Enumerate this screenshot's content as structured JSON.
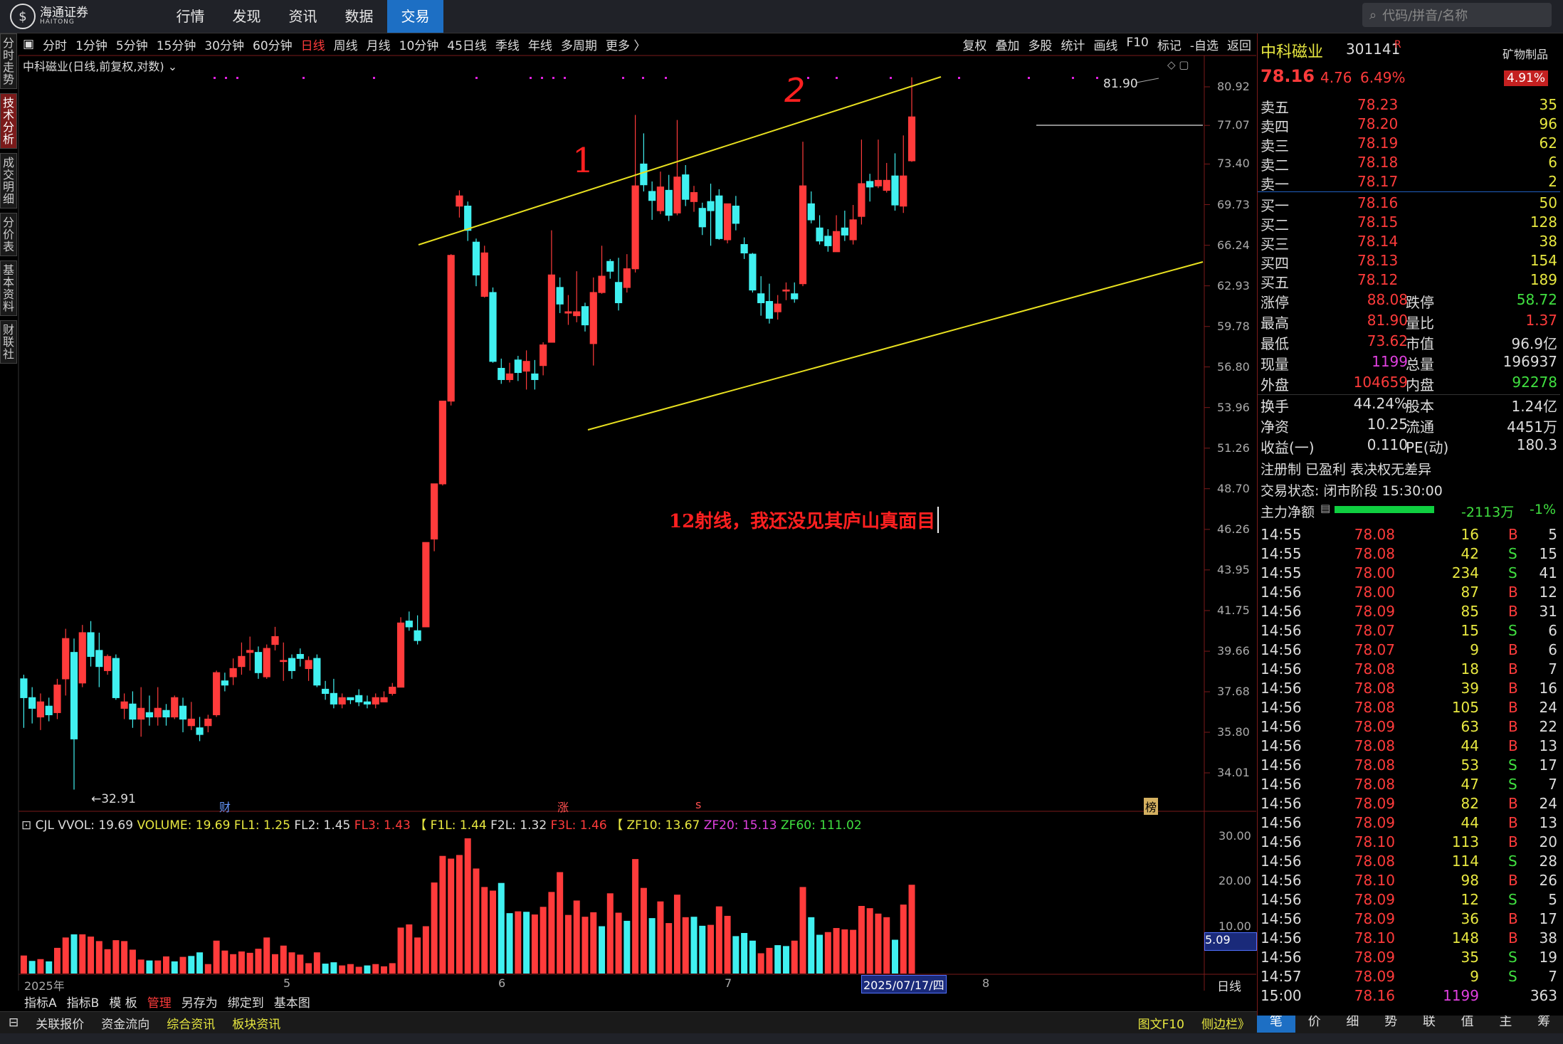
{
  "app": {
    "logo_text": "海通证券",
    "logo_sub": "HAITONG",
    "nav": [
      "行情",
      "发现",
      "资讯",
      "数据",
      "交易"
    ],
    "active_nav": "交易",
    "search_placeholder": "代码/拼音/名称"
  },
  "side_tabs": [
    "分时走势",
    "技术分析",
    "成交明细",
    "分价表",
    "基本资料",
    "财联社"
  ],
  "active_side": "技术分析",
  "toolbar": {
    "periods": [
      "分时",
      "1分钟",
      "5分钟",
      "15分钟",
      "30分钟",
      "60分钟",
      "日线",
      "周线",
      "月线",
      "10分钟",
      "45日线",
      "季线",
      "年线",
      "多周期",
      "更多 〉"
    ],
    "active": "日线",
    "right": [
      "复权",
      "叠加",
      "多股",
      "统计",
      "画线",
      "F10",
      "标记",
      "-自选",
      "返回"
    ]
  },
  "chart_title": "中科磁业(日线,前复权,对数)",
  "annotation_text": "12射线，我还没见其庐山真面目",
  "marks": {
    "one": "1",
    "two": "2",
    "high": "81.90",
    "low": "←32.91",
    "cai": "财",
    "zhang": "涨",
    "s": "s",
    "bang": "榜"
  },
  "y_ticks": [
    "80.92",
    "77.07",
    "73.40",
    "69.73",
    "66.24",
    "62.93",
    "59.78",
    "56.80",
    "53.96",
    "51.26",
    "48.70",
    "46.26",
    "43.95",
    "41.75",
    "39.66",
    "37.68",
    "35.80",
    "34.01"
  ],
  "vol_header": {
    "cjl": "CJL",
    "vvol": "VVOL: 19.69",
    "volume": "VOLUME: 19.69",
    "fl1": "FL1: 1.25",
    "fl2": "FL2: 1.45",
    "fl3": "FL3: 1.43",
    "bracket1": "【",
    "f1l": "F1L: 1.44",
    "f2l": "F2L: 1.32",
    "f3l": "F3L: 1.46",
    "bracket2": "【",
    "zf10": "ZF10: 13.67",
    "zf20": "ZF20: 15.13",
    "zf60": "ZF60: 111.02"
  },
  "vol_ticks": [
    "30.00",
    "20.00",
    "10.00"
  ],
  "vol_current": "5.09",
  "x_labels": [
    "2025年",
    "5",
    "6",
    "7",
    "2025/07/17/四",
    "8"
  ],
  "period_label": "日线",
  "bottom_tabs": [
    "指标A",
    "指标B",
    "模 板",
    "管理",
    "另存为",
    "绑定到",
    "基本图"
  ],
  "status_tabs": [
    "关联报价",
    "资金流向",
    "综合资讯",
    "板块资讯"
  ],
  "status_right": [
    "图文F10",
    "侧边栏》"
  ],
  "quote": {
    "name": "中科磁业",
    "code": "301141",
    "tag": "R",
    "sector": "矿物制品",
    "sector_pct": "4.91%",
    "price": "78.16",
    "change": "4.76",
    "pct": "6.49%",
    "asks": [
      [
        "卖五",
        "78.23",
        "35"
      ],
      [
        "卖四",
        "78.20",
        "96"
      ],
      [
        "卖三",
        "78.19",
        "62"
      ],
      [
        "卖二",
        "78.18",
        "6"
      ],
      [
        "卖一",
        "78.17",
        "2"
      ]
    ],
    "bids": [
      [
        "买一",
        "78.16",
        "50"
      ],
      [
        "买二",
        "78.15",
        "128"
      ],
      [
        "买三",
        "78.14",
        "38"
      ],
      [
        "买四",
        "78.13",
        "154"
      ],
      [
        "买五",
        "78.12",
        "189"
      ]
    ],
    "stats": [
      [
        "涨停",
        "88.08",
        "跌停",
        "58.72"
      ],
      [
        "最高",
        "81.90",
        "量比",
        "1.37"
      ],
      [
        "最低",
        "73.62",
        "市值",
        "96.9亿"
      ],
      [
        "现量",
        "1199",
        "总量",
        "196937"
      ],
      [
        "外盘",
        "104659",
        "内盘",
        "92278"
      ]
    ],
    "stats2": [
      [
        "换手",
        "44.24%",
        "股本",
        "1.24亿"
      ],
      [
        "净资",
        "10.25",
        "流通",
        "4451万"
      ],
      [
        "收益(一)",
        "0.110",
        "PE(动)",
        "180.3"
      ]
    ],
    "reg": "注册制 已盈利 表决权无差异",
    "trade_status": "交易状态: 闭市阶段 15:30:00",
    "main_flow_label": "主力净额",
    "main_flow_value": "-2113万",
    "main_flow_pct": "-1%"
  },
  "ticks": [
    [
      "14:55",
      "78.08",
      "16",
      "B",
      "5"
    ],
    [
      "14:55",
      "78.08",
      "42",
      "S",
      "15"
    ],
    [
      "14:55",
      "78.00",
      "234",
      "S",
      "41"
    ],
    [
      "14:56",
      "78.00",
      "87",
      "B",
      "12"
    ],
    [
      "14:56",
      "78.09",
      "85",
      "B",
      "31"
    ],
    [
      "14:56",
      "78.07",
      "15",
      "S",
      "6"
    ],
    [
      "14:56",
      "78.07",
      "9",
      "B",
      "6"
    ],
    [
      "14:56",
      "78.08",
      "18",
      "B",
      "7"
    ],
    [
      "14:56",
      "78.08",
      "39",
      "B",
      "16"
    ],
    [
      "14:56",
      "78.08",
      "105",
      "B",
      "24"
    ],
    [
      "14:56",
      "78.09",
      "63",
      "B",
      "22"
    ],
    [
      "14:56",
      "78.08",
      "44",
      "B",
      "13"
    ],
    [
      "14:56",
      "78.08",
      "53",
      "S",
      "17"
    ],
    [
      "14:56",
      "78.08",
      "47",
      "S",
      "7"
    ],
    [
      "14:56",
      "78.09",
      "82",
      "B",
      "24"
    ],
    [
      "14:56",
      "78.09",
      "44",
      "B",
      "13"
    ],
    [
      "14:56",
      "78.10",
      "113",
      "B",
      "20"
    ],
    [
      "14:56",
      "78.08",
      "114",
      "S",
      "28"
    ],
    [
      "14:56",
      "78.10",
      "98",
      "B",
      "26"
    ],
    [
      "14:56",
      "78.09",
      "12",
      "S",
      "5"
    ],
    [
      "14:56",
      "78.09",
      "36",
      "B",
      "17"
    ],
    [
      "14:56",
      "78.10",
      "148",
      "B",
      "38"
    ],
    [
      "14:56",
      "78.09",
      "35",
      "S",
      "19"
    ],
    [
      "14:57",
      "78.09",
      "9",
      "S",
      "7"
    ],
    [
      "15:00",
      "78.16",
      "1199",
      "",
      "363"
    ]
  ],
  "tick_tabs": [
    "笔",
    "价",
    "细",
    "势",
    "联",
    "值",
    "主",
    "筹"
  ],
  "candles": [
    [
      38.3,
      37.4,
      38.5,
      36.0
    ],
    [
      37.4,
      36.9,
      37.9,
      36.2
    ],
    [
      36.5,
      37.2,
      37.6,
      35.9
    ],
    [
      37.0,
      36.6,
      37.4,
      36.3
    ],
    [
      36.7,
      38.0,
      38.3,
      36.4
    ],
    [
      38.3,
      40.3,
      40.8,
      37.5
    ],
    [
      39.6,
      35.5,
      40.3,
      33.3
    ],
    [
      38.1,
      40.6,
      41.0,
      37.9
    ],
    [
      40.6,
      39.4,
      41.2,
      38.9
    ],
    [
      39.7,
      38.9,
      40.6,
      37.9
    ],
    [
      38.7,
      39.4,
      39.5,
      38.5
    ],
    [
      39.3,
      37.4,
      39.5,
      37.3
    ],
    [
      36.9,
      37.2,
      37.6,
      36.4
    ],
    [
      37.1,
      36.4,
      37.7,
      36.0
    ],
    [
      36.4,
      36.9,
      37.9,
      35.6
    ],
    [
      36.7,
      36.5,
      37.5,
      36.1
    ],
    [
      36.5,
      36.9,
      37.9,
      36.1
    ],
    [
      36.8,
      36.5,
      37.1,
      36.1
    ],
    [
      36.5,
      37.4,
      37.5,
      36.4
    ],
    [
      37.0,
      36.4,
      37.4,
      35.8
    ],
    [
      36.1,
      36.4,
      37.2,
      35.9
    ],
    [
      36.0,
      35.7,
      36.5,
      35.4
    ],
    [
      36.1,
      36.4,
      36.6,
      35.8
    ],
    [
      36.6,
      38.6,
      38.7,
      36.5
    ],
    [
      38.2,
      38.0,
      38.6,
      37.7
    ],
    [
      38.4,
      38.8,
      39.3,
      38.0
    ],
    [
      38.9,
      39.4,
      40.1,
      38.5
    ],
    [
      39.6,
      39.7,
      40.4,
      38.7
    ],
    [
      39.6,
      38.6,
      39.9,
      38.3
    ],
    [
      38.4,
      39.8,
      40.0,
      38.3
    ],
    [
      40.0,
      40.4,
      40.9,
      39.7
    ],
    [
      39.2,
      39.2,
      40.1,
      38.2
    ],
    [
      39.3,
      38.7,
      39.5,
      38.3
    ],
    [
      39.5,
      39.3,
      39.8,
      38.9
    ],
    [
      38.8,
      39.2,
      39.4,
      38.2
    ],
    [
      39.3,
      38.0,
      39.5,
      37.9
    ],
    [
      37.8,
      37.6,
      38.2,
      37.3
    ],
    [
      37.6,
      37.1,
      38.3,
      36.9
    ],
    [
      37.1,
      37.4,
      37.6,
      36.9
    ],
    [
      37.4,
      37.3,
      37.4,
      37.1
    ],
    [
      37.5,
      37.2,
      37.8,
      37.0
    ],
    [
      37.2,
      37.1,
      37.5,
      36.9
    ],
    [
      37.1,
      37.4,
      37.6,
      36.9
    ],
    [
      37.2,
      37.4,
      37.7,
      37.3
    ],
    [
      37.6,
      37.9,
      38.1,
      37.5
    ],
    [
      37.9,
      41.1,
      41.4,
      37.9
    ],
    [
      41.2,
      40.9,
      41.7,
      40.7
    ],
    [
      40.7,
      40.2,
      41.5,
      40.0
    ],
    [
      40.9,
      45.5,
      45.5,
      40.9
    ],
    [
      45.7,
      49.0,
      49.0,
      45.0
    ],
    [
      49.0,
      54.4,
      54.4,
      48.9
    ],
    [
      54.4,
      65.4,
      65.5,
      54.1
    ],
    [
      69.6,
      70.5,
      71.0,
      68.6
    ],
    [
      69.6,
      67.5,
      70.0,
      66.6
    ],
    [
      66.5,
      63.8,
      66.8,
      62.9
    ],
    [
      62.1,
      65.6,
      66.2,
      62.0
    ],
    [
      62.4,
      57.2,
      62.8,
      57.1
    ],
    [
      56.7,
      55.9,
      57.4,
      55.6
    ],
    [
      55.9,
      56.3,
      57.1,
      55.7
    ],
    [
      57.3,
      56.4,
      57.6,
      55.8
    ],
    [
      56.5,
      57.2,
      58.0,
      55.2
    ],
    [
      56.3,
      55.9,
      57.3,
      55.2
    ],
    [
      56.9,
      58.4,
      58.6,
      56.2
    ],
    [
      58.6,
      63.8,
      67.5,
      58.6
    ],
    [
      62.8,
      61.5,
      63.6,
      60.8
    ],
    [
      60.8,
      60.9,
      62.2,
      59.9
    ],
    [
      60.6,
      60.9,
      64.1,
      60.1
    ],
    [
      61.3,
      59.9,
      61.6,
      59.4
    ],
    [
      58.5,
      62.4,
      63.6,
      56.9
    ],
    [
      62.4,
      63.7,
      66.2,
      62.3
    ],
    [
      64.9,
      64.1,
      65.1,
      63.5
    ],
    [
      63.2,
      61.6,
      65.2,
      61.0
    ],
    [
      62.8,
      64.3,
      65.5,
      62.4
    ],
    [
      64.3,
      71.4,
      78.1,
      64.0
    ],
    [
      73.4,
      71.5,
      76.3,
      70.9
    ],
    [
      70.9,
      70.1,
      71.8,
      68.4
    ],
    [
      69.2,
      71.3,
      72.7,
      68.9
    ],
    [
      71.0,
      68.8,
      72.4,
      68.3
    ],
    [
      69.0,
      72.2,
      77.6,
      68.8
    ],
    [
      72.4,
      70.2,
      73.3,
      69.6
    ],
    [
      70.0,
      70.8,
      71.4,
      69.1
    ],
    [
      69.4,
      67.8,
      69.9,
      67.1
    ],
    [
      70.0,
      69.2,
      71.6,
      66.2
    ],
    [
      70.5,
      66.8,
      71.1,
      66.7
    ],
    [
      66.7,
      69.8,
      69.8,
      66.4
    ],
    [
      69.6,
      68.1,
      70.5,
      67.5
    ],
    [
      66.3,
      65.6,
      66.9,
      65.1
    ],
    [
      65.5,
      62.6,
      65.6,
      62.4
    ],
    [
      62.3,
      61.6,
      63.7,
      60.6
    ],
    [
      61.7,
      60.4,
      63.1,
      60.0
    ],
    [
      60.9,
      61.5,
      62.2,
      60.3
    ],
    [
      62.6,
      62.6,
      63.2,
      61.8
    ],
    [
      62.3,
      61.9,
      63.2,
      61.6
    ],
    [
      63.1,
      71.4,
      75.5,
      62.9
    ],
    [
      69.8,
      68.4,
      70.9,
      68.1
    ],
    [
      67.7,
      66.6,
      68.8,
      66.3
    ],
    [
      67.0,
      66.2,
      67.6,
      65.7
    ],
    [
      65.7,
      67.4,
      68.8,
      65.7
    ],
    [
      67.7,
      67.1,
      69.2,
      66.6
    ],
    [
      66.7,
      68.4,
      69.7,
      66.3
    ],
    [
      68.7,
      71.6,
      75.7,
      68.0
    ],
    [
      71.8,
      71.3,
      72.5,
      70.0
    ],
    [
      71.4,
      71.9,
      75.7,
      71.2
    ],
    [
      71.0,
      71.9,
      73.5,
      70.8
    ],
    [
      72.3,
      69.7,
      74.4,
      69.2
    ],
    [
      69.6,
      72.3,
      76.1,
      69.0
    ],
    [
      73.7,
      77.9,
      81.9,
      73.6
    ]
  ],
  "volumes": [
    [
      4.0,
      "u"
    ],
    [
      2.8,
      "d"
    ],
    [
      3.2,
      "u"
    ],
    [
      2.7,
      "d"
    ],
    [
      5.7,
      "u"
    ],
    [
      8.0,
      "u"
    ],
    [
      8.7,
      "d"
    ],
    [
      8.7,
      "u"
    ],
    [
      8.2,
      "u"
    ],
    [
      7.2,
      "u"
    ],
    [
      5.4,
      "u"
    ],
    [
      7.4,
      "u"
    ],
    [
      7.2,
      "u"
    ],
    [
      5.3,
      "u"
    ],
    [
      3.1,
      "u"
    ],
    [
      2.9,
      "d"
    ],
    [
      2.9,
      "u"
    ],
    [
      3.8,
      "u"
    ],
    [
      2.7,
      "d"
    ],
    [
      3.7,
      "u"
    ],
    [
      3.9,
      "d"
    ],
    [
      4.7,
      "d"
    ],
    [
      2.1,
      "u"
    ],
    [
      7.3,
      "u"
    ],
    [
      5.1,
      "u"
    ],
    [
      4.3,
      "u"
    ],
    [
      4.9,
      "u"
    ],
    [
      4.6,
      "u"
    ],
    [
      5.5,
      "u"
    ],
    [
      8.0,
      "u"
    ],
    [
      4.3,
      "u"
    ],
    [
      6.2,
      "u"
    ],
    [
      4.7,
      "u"
    ],
    [
      4.2,
      "u"
    ],
    [
      2.3,
      "u"
    ],
    [
      4.7,
      "u"
    ],
    [
      2.2,
      "d"
    ],
    [
      2.5,
      "d"
    ],
    [
      1.8,
      "u"
    ],
    [
      2.1,
      "u"
    ],
    [
      1.5,
      "u"
    ],
    [
      1.8,
      "d"
    ],
    [
      2.1,
      "u"
    ],
    [
      1.6,
      "u"
    ],
    [
      2.3,
      "u"
    ],
    [
      10.2,
      "u"
    ],
    [
      10.9,
      "u"
    ],
    [
      8.0,
      "u"
    ],
    [
      10.5,
      "u"
    ],
    [
      20.2,
      "u"
    ],
    [
      26.1,
      "u"
    ],
    [
      25.5,
      "u"
    ],
    [
      26.3,
      "u"
    ],
    [
      30.0,
      "u"
    ],
    [
      23.3,
      "u"
    ],
    [
      19.2,
      "u"
    ],
    [
      18.4,
      "u"
    ],
    [
      20.1,
      "d"
    ],
    [
      13.4,
      "d"
    ],
    [
      13.8,
      "u"
    ],
    [
      13.7,
      "d"
    ],
    [
      13.1,
      "u"
    ],
    [
      14.8,
      "u"
    ],
    [
      18.1,
      "u"
    ],
    [
      22.5,
      "u"
    ],
    [
      13.0,
      "u"
    ],
    [
      16.2,
      "u"
    ],
    [
      12.6,
      "u"
    ],
    [
      13.6,
      "u"
    ],
    [
      10.5,
      "d"
    ],
    [
      17.8,
      "u"
    ],
    [
      13.5,
      "u"
    ],
    [
      11.7,
      "d"
    ],
    [
      25.4,
      "u"
    ],
    [
      19.0,
      "u"
    ],
    [
      12.3,
      "d"
    ],
    [
      16.0,
      "u"
    ],
    [
      11.2,
      "u"
    ],
    [
      17.5,
      "u"
    ],
    [
      12.5,
      "u"
    ],
    [
      12.6,
      "d"
    ],
    [
      10.6,
      "d"
    ],
    [
      10.8,
      "u"
    ],
    [
      14.9,
      "u"
    ],
    [
      12.8,
      "u"
    ],
    [
      8.3,
      "d"
    ],
    [
      9.0,
      "d"
    ],
    [
      7.3,
      "d"
    ],
    [
      4.5,
      "u"
    ],
    [
      5.7,
      "u"
    ],
    [
      6.3,
      "d"
    ],
    [
      6.1,
      "d"
    ],
    [
      7.3,
      "u"
    ],
    [
      19.2,
      "u"
    ],
    [
      12.5,
      "d"
    ],
    [
      8.6,
      "d"
    ],
    [
      9.2,
      "u"
    ],
    [
      10.1,
      "u"
    ],
    [
      9.8,
      "u"
    ],
    [
      9.7,
      "u"
    ],
    [
      15.0,
      "u"
    ],
    [
      14.5,
      "u"
    ],
    [
      13.3,
      "u"
    ],
    [
      12.5,
      "u"
    ],
    [
      7.5,
      "d"
    ],
    [
      15.3,
      "u"
    ],
    [
      19.7,
      "u"
    ]
  ]
}
